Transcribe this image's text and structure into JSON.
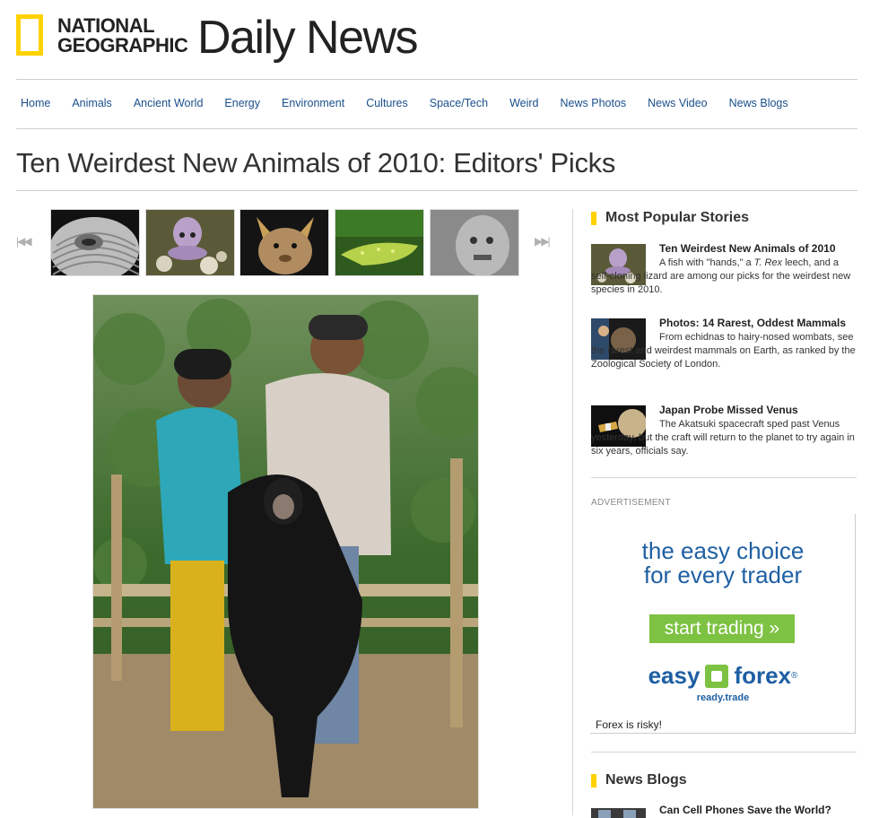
{
  "brand": {
    "logo_line1": "NATIONAL",
    "logo_line2": "GEOGRAPHIC",
    "section_title": "Daily News",
    "accent": "#ffd200"
  },
  "nav": {
    "items": [
      "Home",
      "Animals",
      "Ancient World",
      "Energy",
      "Environment",
      "Cultures",
      "Space/Tech",
      "Weird",
      "News Photos",
      "News Video",
      "News Blogs"
    ]
  },
  "article": {
    "title": "Ten Weirdest New Animals of 2010: Editors' Picks"
  },
  "gallery": {
    "prev_icon": "skip-previous-icon",
    "next_icon": "skip-next-icon",
    "prev_glyph": "|◀◀",
    "next_glyph": "▶▶|"
  },
  "popular": {
    "heading": "Most Popular Stories",
    "stories": [
      {
        "title": "Ten Weirdest New Animals of 2010",
        "body_1": "A fish with \"hands,\" a ",
        "body_em": "T. Rex",
        "body_2": " leech, and a self-cloning lizard are among our picks for the weirdest new species in 2010."
      },
      {
        "title": "Photos: 14 Rarest, Oddest Mammals",
        "body": "From echidnas to hairy-nosed wombats, see the rarest and weirdest mammals on Earth, as ranked by the Zoological Society of London."
      },
      {
        "title": "Japan Probe Missed Venus",
        "body": "The Akatsuki spacecraft sped past Venus yesterday, but the craft will return to the planet to try again in six years, officials say."
      }
    ]
  },
  "ad": {
    "label": "ADVERTISEMENT",
    "headline_1": "the easy choice",
    "headline_2": "for every trader",
    "cta": "start trading »",
    "brand_left": "easy",
    "brand_right": "forex",
    "reg": "®",
    "tagline": "ready.trade",
    "risk": "Forex is risky!"
  },
  "blogs": {
    "heading": "News Blogs",
    "first_title": "Can Cell Phones Save the World?"
  }
}
